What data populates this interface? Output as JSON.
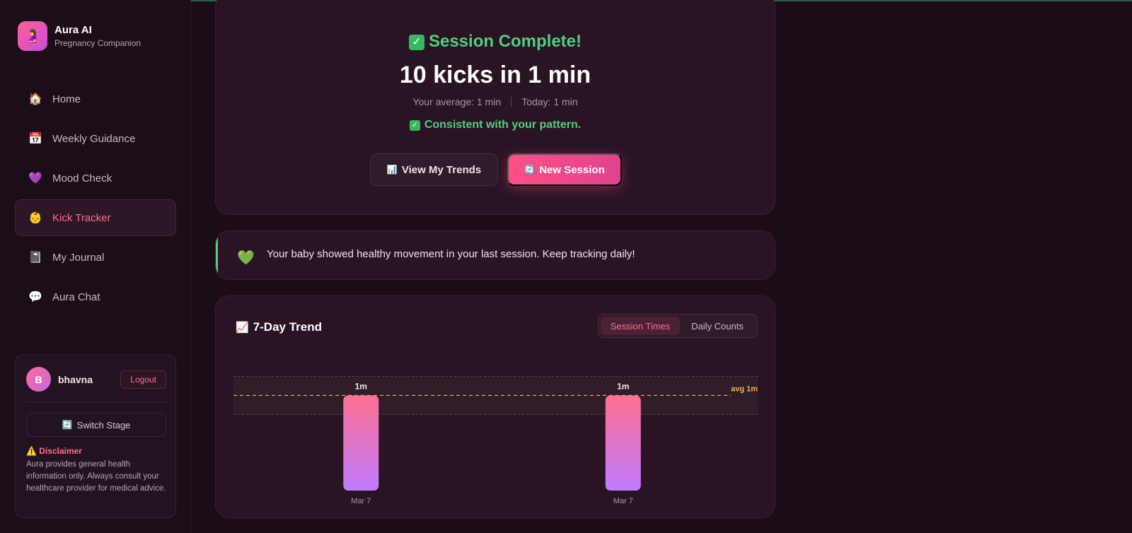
{
  "app": {
    "name": "Aura AI",
    "tagline": "Pregnancy Companion",
    "logo_icon": "pregnant-person-icon"
  },
  "sidebar": {
    "items": [
      {
        "label": "Home",
        "icon": "house-icon",
        "glyph": "🏠",
        "active": false
      },
      {
        "label": "Weekly Guidance",
        "icon": "calendar-icon",
        "glyph": "📅",
        "active": false
      },
      {
        "label": "Mood Check",
        "icon": "purple-heart-icon",
        "glyph": "💜",
        "active": false
      },
      {
        "label": "Kick Tracker",
        "icon": "baby-icon",
        "glyph": "👶",
        "active": true
      },
      {
        "label": "My Journal",
        "icon": "notebook-icon",
        "glyph": "📓",
        "active": false
      },
      {
        "label": "Aura Chat",
        "icon": "speech-bubble-icon",
        "glyph": "💬",
        "active": false
      }
    ]
  },
  "user": {
    "initial": "B",
    "name": "bhavna",
    "logout_label": "Logout",
    "switch_stage_label": "Switch Stage"
  },
  "disclaimer": {
    "title": "⚠️ Disclaimer",
    "text": "Aura provides general health information only. Always consult your healthcare provider for medical advice."
  },
  "session": {
    "title": "Session Complete!",
    "result": "10 kicks in 1 min",
    "average": "Your average: 1 min",
    "today": "Today: 1 min",
    "consistency": "Consistent with your pattern.",
    "trends_button": "View My Trends",
    "new_button": "New Session"
  },
  "message": {
    "text": "Your baby showed healthy movement in your last session. Keep tracking daily!"
  },
  "trend": {
    "title": "7-Day Trend",
    "tabs": [
      {
        "label": "Session Times",
        "active": true
      },
      {
        "label": "Daily Counts",
        "active": false
      }
    ]
  },
  "colors": {
    "accent_pink": "#ff6f8f",
    "success_green": "#4ed07f",
    "average_line": "#e3a85a",
    "bar_top": "#ff6f91",
    "bar_bottom": "#c07bff"
  },
  "chart_data": {
    "type": "bar",
    "categories": [
      "Mar 7",
      "Mar 7"
    ],
    "values": [
      1,
      1
    ],
    "value_labels": [
      "1m",
      "1m"
    ],
    "unit": "min",
    "average": 1,
    "average_label": "avg 1m",
    "normal_range": [
      0.8,
      1.2
    ],
    "ylim": [
      0,
      1.3
    ]
  }
}
